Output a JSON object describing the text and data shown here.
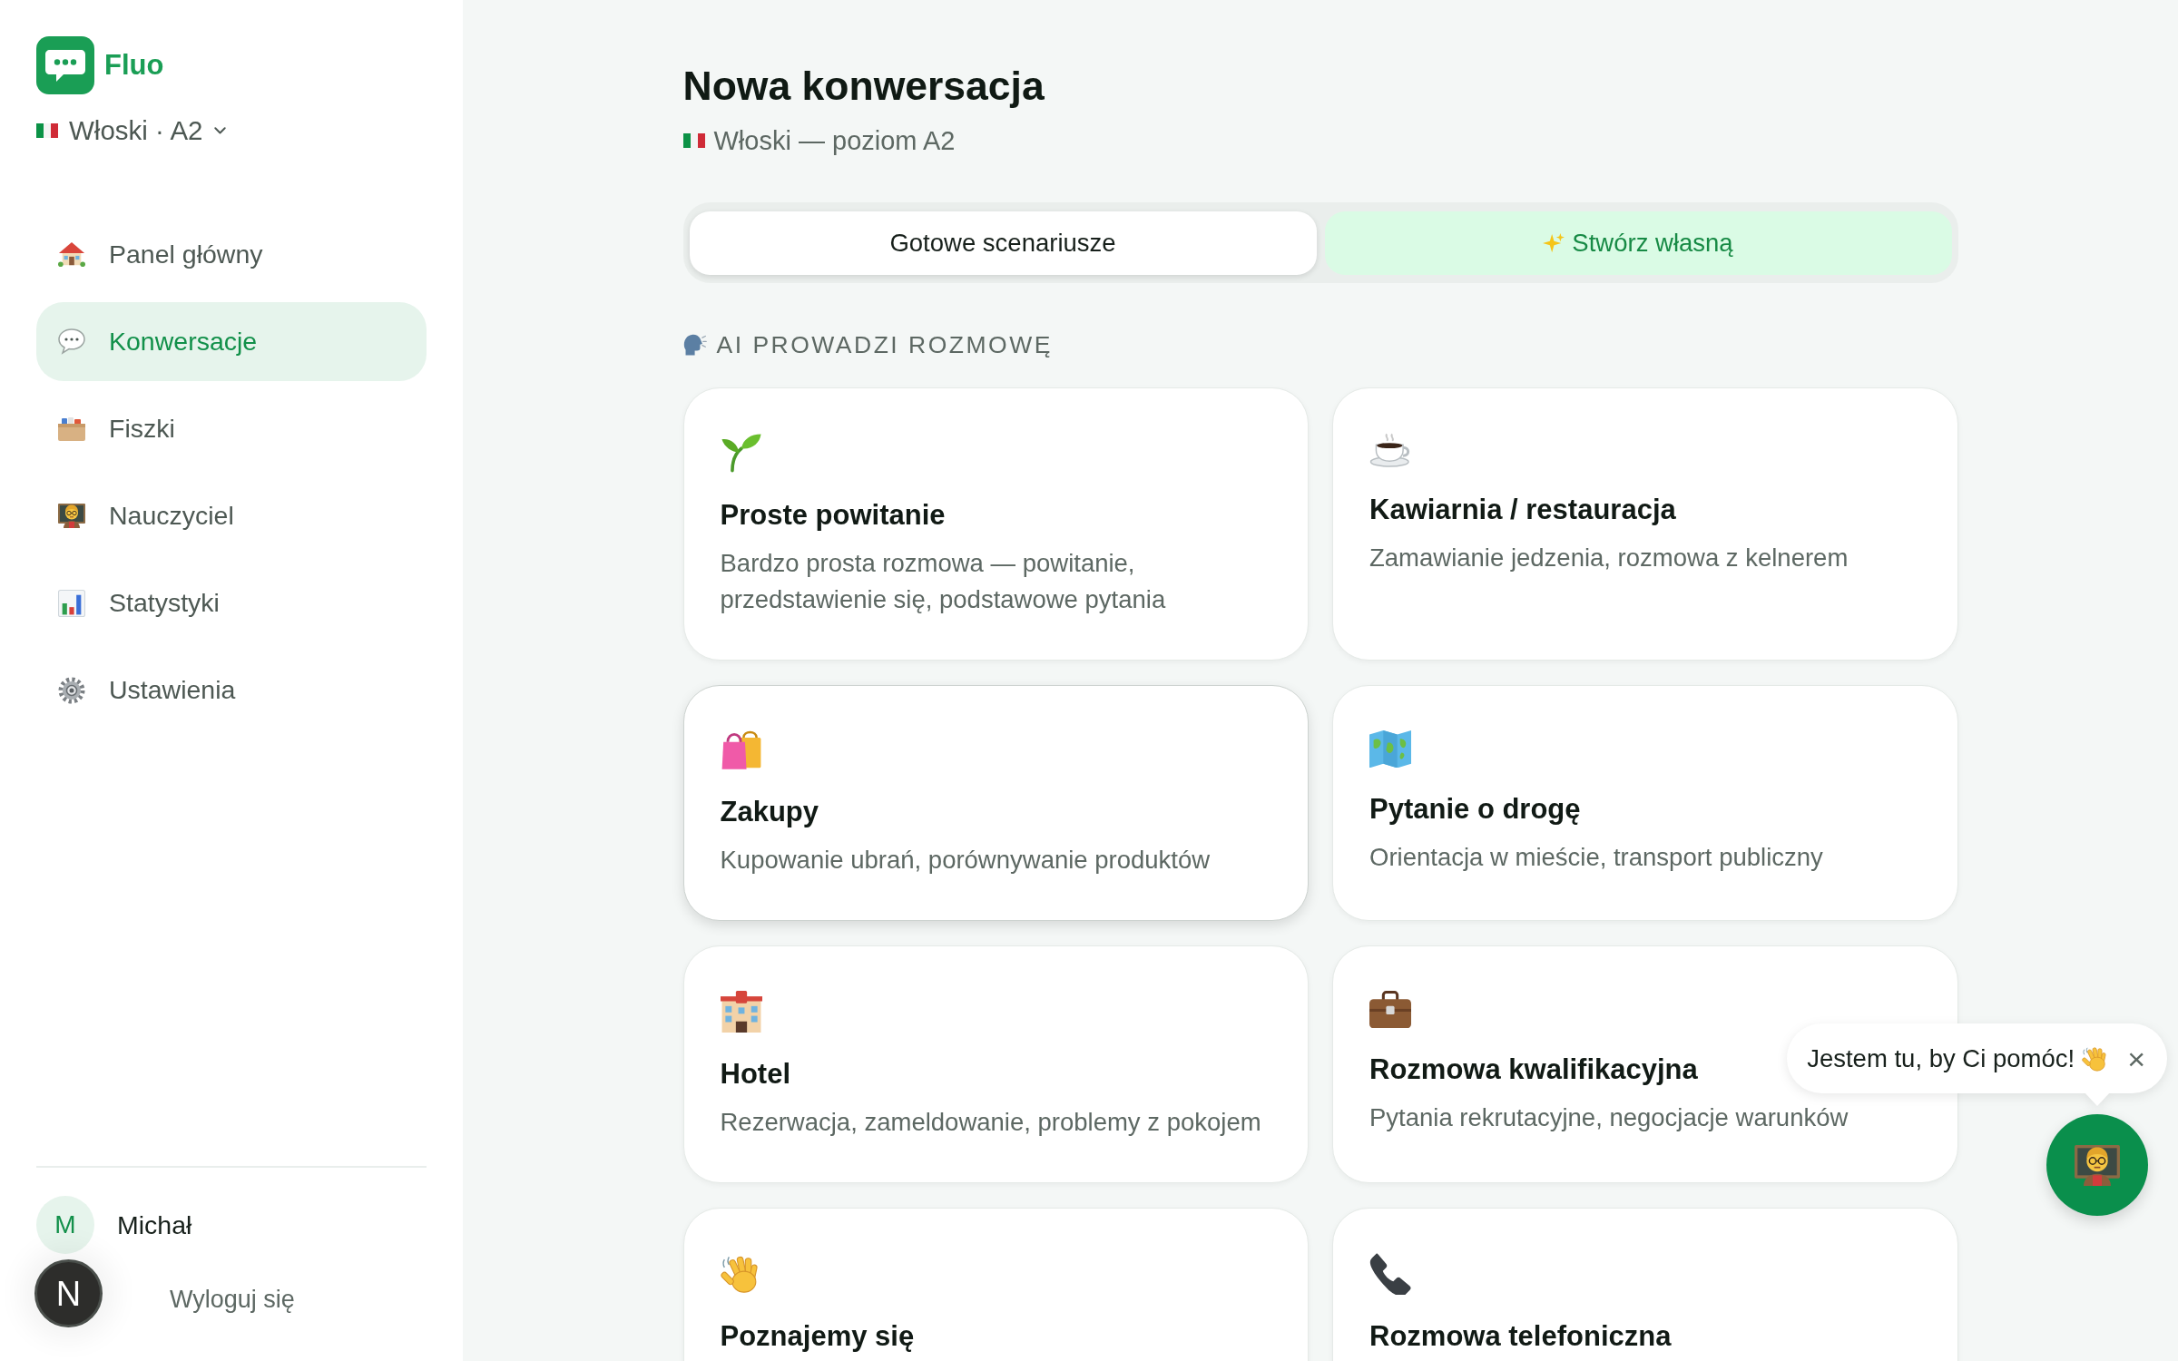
{
  "app": {
    "name": "Fluo"
  },
  "language_selector": {
    "label": "Włoski · A2"
  },
  "sidebar": {
    "items": [
      {
        "label": "Panel główny",
        "selected": false
      },
      {
        "label": "Konwersacje",
        "selected": true
      },
      {
        "label": "Fiszki",
        "selected": false
      },
      {
        "label": "Nauczyciel",
        "selected": false
      },
      {
        "label": "Statystyki",
        "selected": false
      },
      {
        "label": "Ustawienia",
        "selected": false
      }
    ]
  },
  "user": {
    "initial": "M",
    "name": "Michał",
    "logout": "Wyloguj się"
  },
  "dev_indicator": {
    "label": "N"
  },
  "header": {
    "title": "Nowa konwersacja",
    "subtitle": "Włoski — poziom A2"
  },
  "tabs": [
    {
      "label": "Gotowe scenariusze",
      "selected": true,
      "kind": "plain"
    },
    {
      "label": "Stwórz własną",
      "selected": false,
      "kind": "accent"
    }
  ],
  "section": {
    "title": "AI PROWADZI ROZMOWĘ"
  },
  "cards": [
    {
      "title": "Proste powitanie",
      "description": "Bardzo prosta rozmowa — powitanie, przedstawienie się, podstawowe pytania",
      "hovered": false
    },
    {
      "title": "Kawiarnia / restauracja",
      "description": "Zamawianie jedzenia, rozmowa z kelnerem",
      "hovered": false
    },
    {
      "title": "Zakupy",
      "description": "Kupowanie ubrań, porównywanie produktów",
      "hovered": true
    },
    {
      "title": "Pytanie o drogę",
      "description": "Orientacja w mieście, transport publiczny",
      "hovered": false
    },
    {
      "title": "Hotel",
      "description": "Rezerwacja, zameldowanie, problemy z pokojem",
      "hovered": false
    },
    {
      "title": "Rozmowa kwalifikacyjna",
      "description": "Pytania rekrutacyjne, negocjacje warunków",
      "hovered": false
    },
    {
      "title": "Poznajemy się",
      "hovered": false
    },
    {
      "title": "Rozmowa telefoniczna",
      "hovered": false
    }
  ],
  "assistant": {
    "message": "Jestem tu, by Ci pomóc!",
    "close": "×"
  }
}
